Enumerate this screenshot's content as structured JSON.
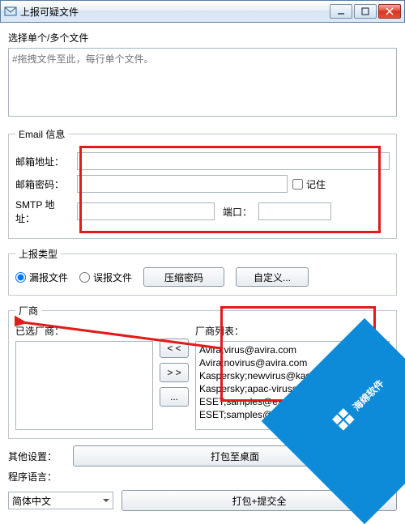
{
  "window": {
    "title": "上报可疑文件"
  },
  "files": {
    "label": "选择单个/多个文件",
    "placeholder": "#拖拽文件至此，每行单个文件。"
  },
  "email": {
    "legend": "Email 信息",
    "addr_label": "邮箱地址：",
    "pass_label": "邮箱密码：",
    "remember_label": "记住",
    "smtp_label": "SMTP 地址：",
    "port_label": "端口："
  },
  "uptype": {
    "legend": "上报类型",
    "miss_label": "漏报文件",
    "false_label": "误报文件",
    "zip_btn": "压缩密码",
    "custom_btn": "自定义..."
  },
  "vendor": {
    "legend": "厂商",
    "selected_label": "已选厂商：",
    "list_label": "厂商列表：",
    "move_left": "< <",
    "move_right": "> >",
    "more": "...",
    "items": [
      "Avira;virus@avira.com",
      "Avira;novirus@avira.com",
      "Kaspersky;newvirus@kaspersk",
      "Kaspersky;apac-virussample@",
      "ESET;samples@eset.sk",
      "ESET;samples@eset.com"
    ]
  },
  "other": {
    "label": "其他设置：",
    "lang_label": "程序语言：",
    "lang_value": "简体中文",
    "pack_desktop": "打包至桌面",
    "pack_submit": "打包+提交全"
  },
  "watermark": "海绵软件"
}
